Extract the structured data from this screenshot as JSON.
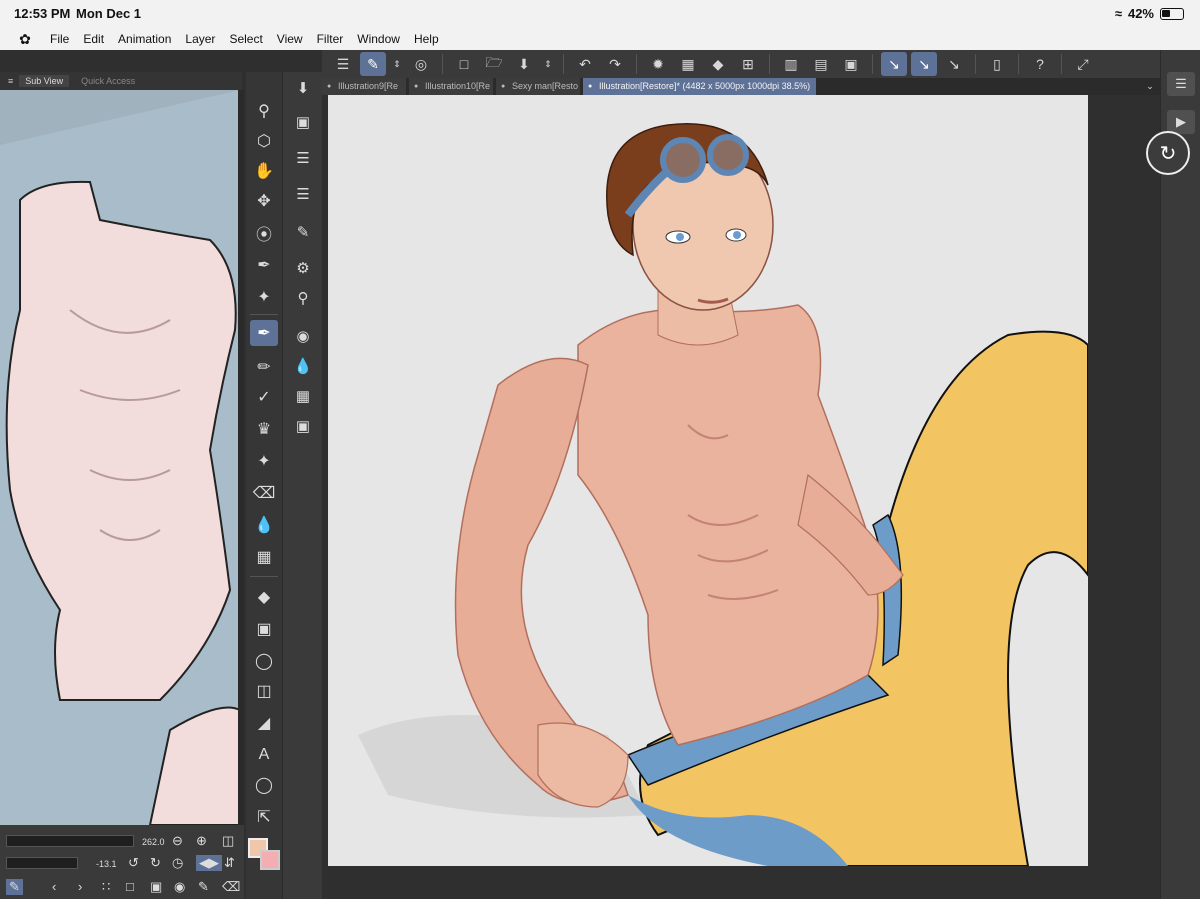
{
  "status": {
    "time": "12:53 PM",
    "date": "Mon Dec 1",
    "battery": "42%"
  },
  "menu": {
    "items": [
      "File",
      "Edit",
      "Animation",
      "Layer",
      "Select",
      "View",
      "Filter",
      "Window",
      "Help"
    ]
  },
  "subview": {
    "tab_sub": "Sub View",
    "tab_quick": "Quick Access",
    "zoom_value": "262.0",
    "rotate_value": "-13.1"
  },
  "tabs": [
    {
      "label": "Illustration9[Re"
    },
    {
      "label": "Illustration10[Re"
    },
    {
      "label": "Sexy man[Resto"
    },
    {
      "label": "Illustration[Restore]* (4482 x 5000px 1000dpi 38.5%)"
    }
  ],
  "colors": {
    "main": "#f1c7ab",
    "sub": "#f2aeb0",
    "accent": "#5e7197",
    "canvas_bg": "#e6e6e6"
  },
  "icons": {
    "tools": [
      "magnifier-icon",
      "3d-icon",
      "hand-icon",
      "move-icon",
      "lasso-icon",
      "eyedropper-icon",
      "auto-select-icon",
      "pen-icon",
      "pencil-icon",
      "brush-icon",
      "airbrush-icon",
      "decoration-icon",
      "eraser-icon",
      "blend-icon",
      "figure-icon",
      "fill-icon",
      "gradient-icon",
      "shape-icon",
      "frame-icon",
      "ruler-icon",
      "text-icon",
      "balloon-icon",
      "correct-line-icon"
    ],
    "sub_tools": [
      "import-icon",
      "camera-icon",
      "layers-3d-icon",
      "layers-icon",
      "properties-icon",
      "sliders-icon",
      "search-icon",
      "record-icon",
      "droplet-icon",
      "palette-icon",
      "film-icon"
    ]
  }
}
